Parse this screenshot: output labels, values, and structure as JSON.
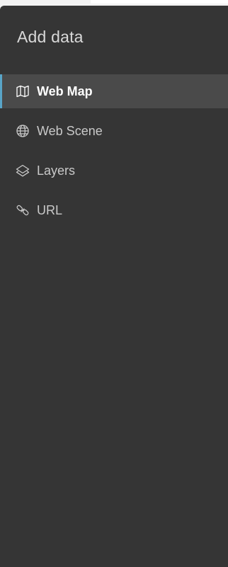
{
  "panel": {
    "title": "Add data",
    "active_item": "Web Map",
    "accent_color": "#59a5c8",
    "background_color": "#353535"
  },
  "nav": {
    "items": [
      {
        "label": "Web Map",
        "icon": "map-icon"
      },
      {
        "label": "Web Scene",
        "icon": "globe-icon"
      },
      {
        "label": "Layers",
        "icon": "layers-icon"
      },
      {
        "label": "URL",
        "icon": "link-icon"
      }
    ]
  }
}
